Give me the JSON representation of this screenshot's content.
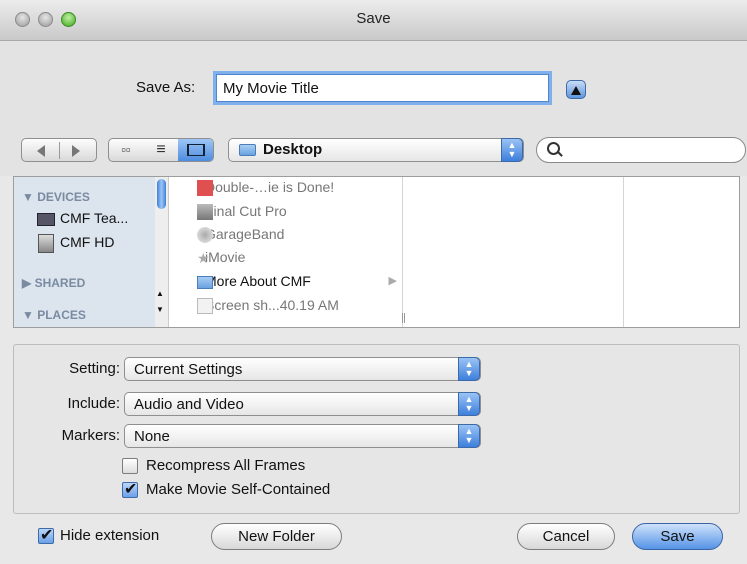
{
  "window": {
    "title": "Save"
  },
  "save_as": {
    "label": "Save As:",
    "value": "My Movie Title"
  },
  "location": {
    "label": "Desktop",
    "search_placeholder": ""
  },
  "sidebar": {
    "devices_header": "DEVICES",
    "devices": [
      "CMF Tea...",
      "CMF HD"
    ],
    "shared_header": "SHARED",
    "places_header": "PLACES"
  },
  "files": [
    {
      "name": "Double-…ie is Done!",
      "icon": "document-icon"
    },
    {
      "name": "Final Cut Pro",
      "icon": "application-icon"
    },
    {
      "name": "GarageBand",
      "icon": "guitar-icon"
    },
    {
      "name": "iMovie",
      "icon": "star-icon"
    },
    {
      "name": "More About CMF",
      "icon": "folder-icon"
    },
    {
      "name": "Screen sh...40.19 AM",
      "icon": "image-icon"
    }
  ],
  "options": {
    "setting": {
      "label": "Setting:",
      "value": "Current Settings"
    },
    "include": {
      "label": "Include:",
      "value": "Audio and Video"
    },
    "markers": {
      "label": "Markers:",
      "value": "None"
    },
    "recompress": {
      "label": "Recompress All Frames",
      "checked": false
    },
    "self_contained": {
      "label": "Make Movie Self-Contained",
      "checked": true
    }
  },
  "footer": {
    "hide_extension": {
      "label": "Hide extension",
      "checked": true
    },
    "new_folder": "New Folder",
    "cancel": "Cancel",
    "save": "Save"
  },
  "colors": {
    "accent": "#5593e6",
    "sidebar": "#dce4ee",
    "focus": "#7fb0ec"
  }
}
